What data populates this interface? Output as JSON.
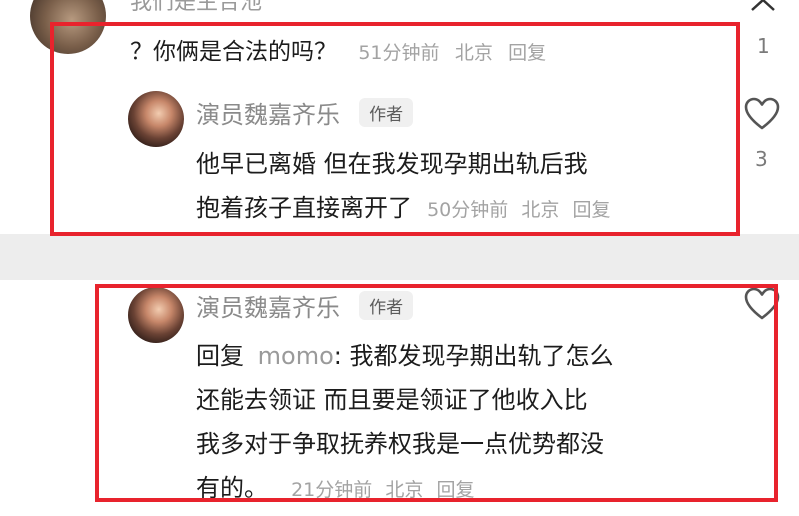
{
  "comment_top": {
    "truncated_text": "我们是主合池",
    "reply_text": "？你俩是合法的吗？",
    "time": "51分钟前",
    "location": "北京",
    "reply_label": "回复",
    "like_count": "1"
  },
  "reply1": {
    "author": "演员魏嘉齐乐",
    "author_tag": "作者",
    "lines": [
      "他早已离婚 但在我发现孕期出轨后我",
      "抱着孩子直接离开了"
    ],
    "time": "50分钟前",
    "location": "北京",
    "reply_label": "回复",
    "like_count": "3"
  },
  "reply2": {
    "author": "演员魏嘉齐乐",
    "author_tag": "作者",
    "reply_prefix": "回复",
    "mention": "momo",
    "lines": [
      ": 我都发现孕期出轨了怎么",
      "还能去领证 而且要是领证了他收入比",
      "我多对于争取抚养权我是一点优势都没",
      "有的。"
    ],
    "time": "21分钟前",
    "location": "北京",
    "reply_label": "回复"
  },
  "colors": {
    "highlight_box": "#e8232d",
    "meta_text": "#a3a3a3",
    "author_tag_bg": "#f0f0f0"
  },
  "icons": [
    "chevron-up-icon",
    "heart-icon"
  ]
}
